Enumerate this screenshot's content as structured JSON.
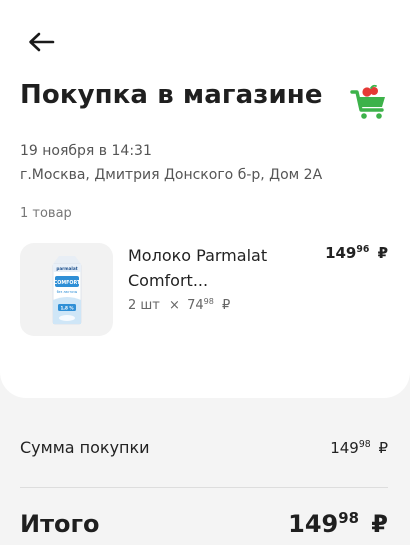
{
  "header": {
    "title": "Покупка в магазине"
  },
  "receipt": {
    "date": "19 ноября в 14:31",
    "address": "г.Москва, Дмитрия Донского б-р, Дом 2А",
    "items_count": "1 товар"
  },
  "items": [
    {
      "name_line1": "Молоко Parmalat",
      "name_line2": "Comfort...",
      "qty": "2 шт",
      "times": "×",
      "unit_price_rub": "74",
      "unit_price_kop": "98",
      "total_rub": "149",
      "total_kop": "96",
      "currency": "₽",
      "package": {
        "brand": "parmalat",
        "label": "COMFORT",
        "sublabel": "без лактозы",
        "fat": "1,8 %"
      }
    }
  ],
  "summary": {
    "subtotal_label": "Сумма покупки",
    "subtotal_rub": "149",
    "subtotal_kop": "98",
    "total_label": "Итого",
    "total_rub": "149",
    "total_kop": "98",
    "currency": "₽"
  },
  "colors": {
    "cart_green": "#3db24a",
    "cart_red": "#e53935",
    "package_blue": "#2f8fd6"
  },
  "icons": {
    "back": "arrow-left-icon",
    "cart": "shopping-cart-icon"
  }
}
